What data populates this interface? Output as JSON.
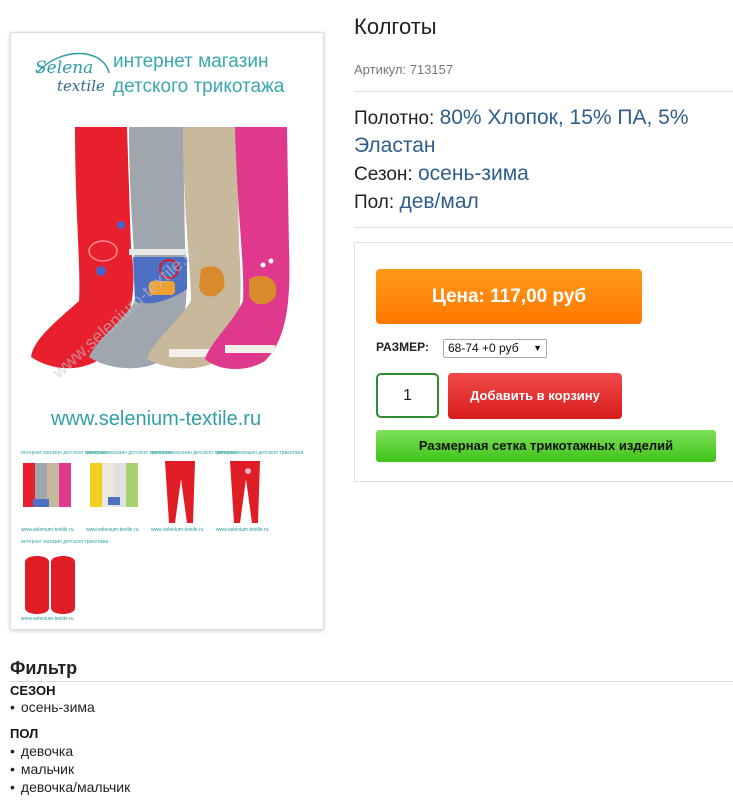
{
  "product": {
    "title": "Колготы",
    "sku_label": "Артикул:",
    "sku_value": "713157",
    "properties": [
      {
        "label": "Полотно:",
        "value": "80% Хлопок, 15% ПА, 5% Эластан"
      },
      {
        "label": "Сезон:",
        "value": "осень-зима"
      },
      {
        "label": "Пол:",
        "value": "дев/мал"
      }
    ]
  },
  "gallery": {
    "logo_script_top": "Selena",
    "logo_script_bottom": "textile",
    "header_line1": "интернет магазин",
    "header_line2": "детского трикотажа",
    "site_url": "www.selenium-textile.ru",
    "watermark": "www.selenium-textile.ru",
    "thumb_header": "интернет магазин детского трикотажа",
    "thumb_url": "www.selenium-textile.ru"
  },
  "buy": {
    "price_button": "Цена: 117,00 руб",
    "size_label": "РАЗМЕР:",
    "size_selected": "68-74 +0 руб",
    "quantity": "1",
    "add_to_cart": "Добавить в корзину",
    "size_chart": "Размерная сетка трикотажных изделий"
  },
  "filter": {
    "title": "Фильтр",
    "groups": [
      {
        "name": "СЕЗОН",
        "items": [
          "осень-зима"
        ]
      },
      {
        "name": "ПОЛ",
        "items": [
          "девочка",
          "мальчик",
          "девочка/мальчик"
        ]
      }
    ]
  },
  "colors": {
    "accent_orange": "#ff8a00",
    "cart_red": "#e02a2a",
    "green_button": "#4cc81f",
    "logo_teal": "#38a8a8",
    "value_blue": "#2f5e8c"
  },
  "icons": {
    "select_caret": "chevron-down-icon"
  }
}
